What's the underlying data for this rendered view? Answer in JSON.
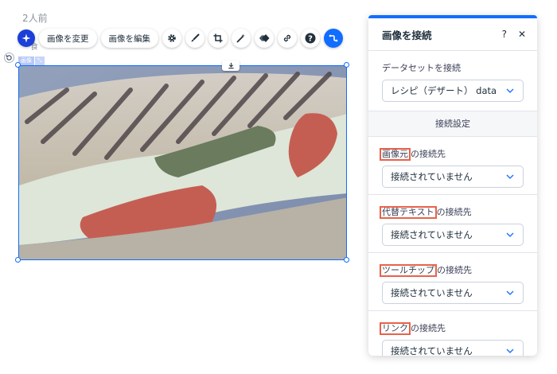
{
  "canvas": {
    "time_label": "2人前",
    "small_label": "食",
    "image_tag": [
      "画像",
      "⤡"
    ]
  },
  "toolbar": {
    "change_image_label": "画像を変更",
    "edit_image_label": "画像を編集"
  },
  "panel": {
    "title": "画像を接続",
    "help": "?",
    "close": "✕",
    "dataset_label": "データセットを接続",
    "dataset_value": "レシピ（デザート） data",
    "connection_settings_label": "接続設定",
    "connections": [
      {
        "label_highlight": "画像元",
        "label_rest": "の接続先",
        "value": "接続されていません"
      },
      {
        "label_highlight": "代替テキスト",
        "label_rest": "の接続先",
        "value": "接続されていません"
      },
      {
        "label_highlight": "ツールチップ",
        "label_rest": "の接続先",
        "value": "接続されていません"
      },
      {
        "label_highlight": "リンク",
        "label_rest": "の接続先",
        "value": "接続されていません"
      }
    ]
  },
  "colors": {
    "accent": "#116dff",
    "highlight_box": "#e8624a",
    "ai_button": "#1b3fd8"
  }
}
